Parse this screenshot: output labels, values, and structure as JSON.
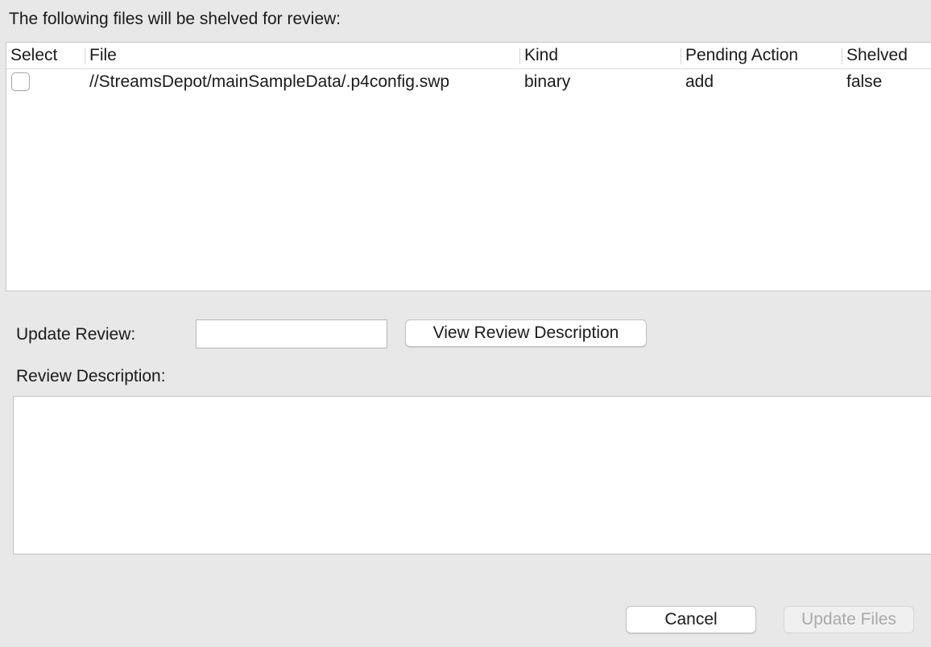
{
  "dialog": {
    "heading": "The following files will be shelved for review:"
  },
  "table": {
    "columns": {
      "select": "Select",
      "file": "File",
      "kind": "Kind",
      "pending_action": "Pending Action",
      "shelved": "Shelved"
    },
    "rows": [
      {
        "selected": false,
        "file": "//StreamsDepot/mainSampleData/.p4config.swp",
        "kind": "binary",
        "pending_action": "add",
        "shelved": "false"
      }
    ]
  },
  "update_review": {
    "label": "Update Review:",
    "value": "",
    "view_button_label": "View Review Description"
  },
  "review_description": {
    "label": "Review Description:",
    "value": ""
  },
  "footer": {
    "cancel_label": "Cancel",
    "update_files_label": "Update Files",
    "update_files_enabled": false
  },
  "colors": {
    "window_background": "#e8e8e8",
    "panel_background": "#ffffff",
    "disabled_text": "#a9a9a9"
  }
}
